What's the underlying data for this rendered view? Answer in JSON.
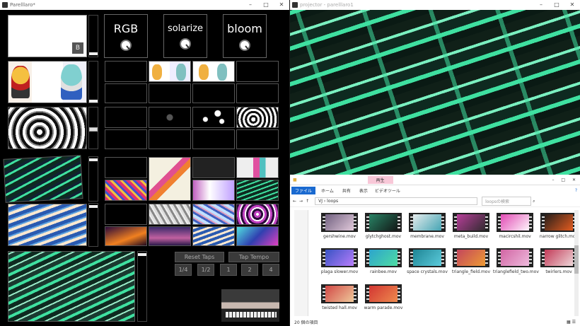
{
  "left_window": {
    "title": "Parelllaro*",
    "controls": [
      "–",
      "□",
      "✕"
    ]
  },
  "right_window": {
    "title": "projector - parelllaro1",
    "controls": [
      "–",
      "□",
      "✕"
    ]
  },
  "preview_badge": "B",
  "effects": [
    {
      "label": "RGB"
    },
    {
      "label": "solarize"
    },
    {
      "label": "bloom"
    }
  ],
  "tempo": {
    "reset_taps": "Reset Taps",
    "tap_tempo": "Tap Tempo",
    "divisions": [
      "1/4",
      "1/2",
      "1",
      "2",
      "4"
    ]
  },
  "explorer": {
    "title_tab": "再生",
    "ribbon_tabs": [
      "ファイル",
      "ホーム",
      "共有",
      "表示",
      "ビデオツール"
    ],
    "path": "VJ › loops",
    "search_placeholder": "loopsの検索",
    "status": "20 個の項目",
    "files": [
      {
        "name": "gershwine.mov",
        "c1": "#6a5a7a",
        "c2": "#e8d0e0"
      },
      {
        "name": "glytchghost.mov",
        "c1": "#2a8a6a",
        "c2": "#111"
      },
      {
        "name": "membrane.mov",
        "c1": "#f0f0f0",
        "c2": "#3aa0b0"
      },
      {
        "name": "meta_build.mov",
        "c1": "#c040a0",
        "c2": "#2a2a2a"
      },
      {
        "name": "macircshil.mov",
        "c1": "#e040b0",
        "c2": "#fff"
      },
      {
        "name": "narrow glitch.mov",
        "c1": "#1a1a1a",
        "c2": "#f06020"
      },
      {
        "name": "plaga slower.mov",
        "c1": "#3050c0",
        "c2": "#c080ff"
      },
      {
        "name": "rainbee.mov",
        "c1": "#2aa0d0",
        "c2": "#50e0a0"
      },
      {
        "name": "space crystals.mov",
        "c1": "#1a8090",
        "c2": "#60d0e0"
      },
      {
        "name": "triangle_field.mov",
        "c1": "#c04060",
        "c2": "#f0a030"
      },
      {
        "name": "trianglefield_two.mov",
        "c1": "#d060a0",
        "c2": "#f0c0e0"
      },
      {
        "name": "twirlers.mov",
        "c1": "#c03050",
        "c2": "#f0e0e0"
      },
      {
        "name": "twisted hall.mov",
        "c1": "#d04040",
        "c2": "#f0d0a0"
      },
      {
        "name": "warm parade.mov",
        "c1": "#d03030",
        "c2": "#f09050"
      }
    ]
  },
  "colors": {
    "green": "#3fe0a0",
    "bg": "#000000"
  }
}
